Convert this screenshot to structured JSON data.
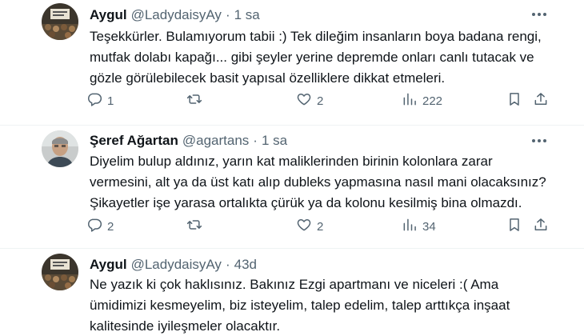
{
  "tweets": [
    {
      "name": "Aygul",
      "handle": "@LadydaisyAy",
      "separator": "·",
      "time": "1 sa",
      "lines": [
        "Teşekkürler. Bulamıyorum tabii :) Tek dileğim insanların boya badana rengi,",
        "mutfak dolabı kapağı... gibi şeyler yerine depremde onları canlı tutacak ve",
        "gözle görülebilecek basit yapısal özelliklere dikkat etmeleri."
      ],
      "stats": {
        "replies": "1",
        "retweets": "",
        "likes": "2",
        "views": "222"
      }
    },
    {
      "name": "Şeref Ağartan",
      "handle": "@agartans",
      "separator": "·",
      "time": "1 sa",
      "lines": [
        "Diyelim bulup aldınız, yarın kat maliklerinden birinin kolonlara zarar",
        "vermesini, alt ya da üst katı alıp dubleks yapmasına nasıl mani olacaksınız?",
        "Şikayetler işe yarasa ortalıkta çürük ya da kolonu kesilmiş bina olmazdı."
      ],
      "stats": {
        "replies": "2",
        "retweets": "",
        "likes": "2",
        "views": "34"
      }
    },
    {
      "name": "Aygul",
      "handle": "@LadydaisyAy",
      "separator": "·",
      "time": "43d",
      "lines": [
        "Ne yazık ki çok haklısınız. Bakınız Ezgi apartmanı ve niceleri :( Ama",
        "ümidimizi kesmeyelim, biz isteyelim, talep edelim, talep arttıkça inşaat",
        "kalitesinde iyileşmeler olacaktır."
      ]
    }
  ],
  "icons": {
    "reply": "reply-icon",
    "retweet": "retweet-icon",
    "like": "like-icon",
    "views": "views-icon",
    "bookmark": "bookmark-icon",
    "share": "share-icon",
    "more": "more-icon"
  },
  "colors": {
    "text": "#0f1419",
    "secondary": "#536471",
    "divider": "#eff3f4"
  }
}
